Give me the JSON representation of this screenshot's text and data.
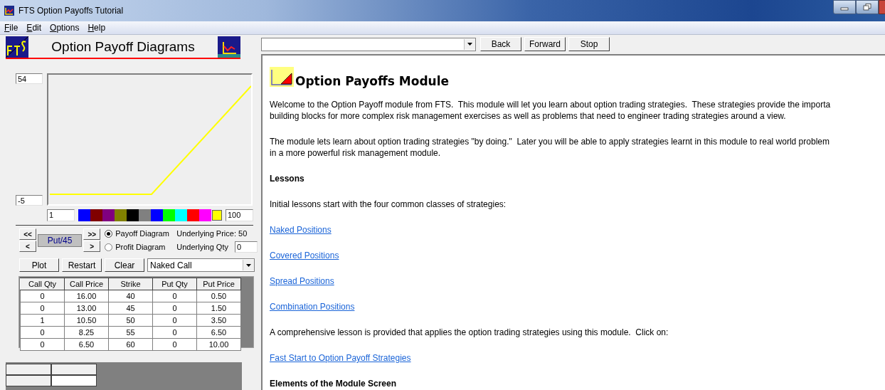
{
  "window": {
    "title": "FTS Option Payoffs Tutorial"
  },
  "menu": [
    {
      "label": "File"
    },
    {
      "label": "Edit"
    },
    {
      "label": "Options"
    },
    {
      "label": "Help"
    }
  ],
  "header": {
    "title": "Option Payoff Diagrams"
  },
  "plot": {
    "y_max": "54",
    "y_min": "-5",
    "x_min": "1",
    "x_max": "100"
  },
  "swatches": [
    {
      "color": "#0000ff",
      "selected": false
    },
    {
      "color": "#800000",
      "selected": false
    },
    {
      "color": "#800080",
      "selected": false
    },
    {
      "color": "#808000",
      "selected": false
    },
    {
      "color": "#000000",
      "selected": false
    },
    {
      "color": "#808080",
      "selected": false
    },
    {
      "color": "#0000ff",
      "selected": false
    },
    {
      "color": "#00ff00",
      "selected": false
    },
    {
      "color": "#00ffff",
      "selected": false
    },
    {
      "color": "#ff0000",
      "selected": false
    },
    {
      "color": "#ff00ff",
      "selected": false
    },
    {
      "color": "#ffff00",
      "selected": true
    }
  ],
  "navigator": {
    "buttons": [
      "<<",
      "<",
      ">>",
      ">"
    ],
    "current": "Put/45"
  },
  "diagram_modes": [
    {
      "label": "Payoff Diagram",
      "selected": true,
      "detail": "Underlying Price: 50"
    },
    {
      "label": "Profit Diagram",
      "selected": false,
      "detail": "Underlying Qty",
      "field_value": "0"
    }
  ],
  "actions": [
    "Plot",
    "Restart",
    "Clear"
  ],
  "strategy_dropdown": {
    "value": "Naked Call"
  },
  "table": {
    "columns": [
      "Call Qty",
      "Call Price",
      "Strike",
      "Put Qty",
      "Put Price"
    ],
    "rows": [
      [
        "0",
        "16.00",
        "40",
        "0",
        "0.50"
      ],
      [
        "0",
        "13.00",
        "45",
        "0",
        "1.50"
      ],
      [
        "1",
        "10.50",
        "50",
        "0",
        "3.50"
      ],
      [
        "0",
        "8.25",
        "55",
        "0",
        "6.50"
      ],
      [
        "0",
        "6.50",
        "60",
        "0",
        "10.00"
      ]
    ]
  },
  "browser": {
    "buttons": [
      "Back",
      "Forward",
      "Stop"
    ]
  },
  "content": [
    {
      "kind": "title",
      "text": "Option Payoffs Module"
    },
    {
      "kind": "paragraph",
      "text": "Welcome to the Option Payoff module from FTS.  This module will let you learn about option trading strategies.  These strategies provide the importa\nbuilding blocks for more complex risk management exercises as well as problems that need to engineer trading strategies around a view."
    },
    {
      "kind": "paragraph",
      "text": "The module lets learn about option trading strategies \"by doing.\"  Later you will be able to apply strategies learnt in this module to real world problem\nin a more powerful risk management module."
    },
    {
      "kind": "heading",
      "text": "Lessons"
    },
    {
      "kind": "paragraph",
      "text": "Initial lessons start with the four common classes of strategies:"
    },
    {
      "kind": "link",
      "text": "Naked Positions"
    },
    {
      "kind": "link",
      "text": "Covered Positions"
    },
    {
      "kind": "link",
      "text": "Spread Positions"
    },
    {
      "kind": "link",
      "text": "Combination Positions"
    },
    {
      "kind": "paragraph",
      "text": "A comprehensive lesson is provided that applies the option trading strategies using this module.  Click on:"
    },
    {
      "kind": "link",
      "text": "Fast Start to Option Payoff Strategies"
    },
    {
      "kind": "heading",
      "text": "Elements of the Module Screen"
    }
  ]
}
